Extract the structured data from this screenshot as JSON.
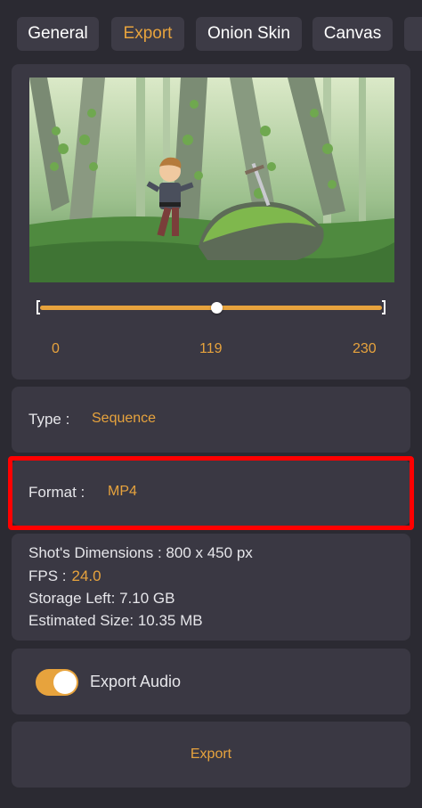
{
  "tabs": [
    {
      "label": "General",
      "active": false
    },
    {
      "label": "Export",
      "active": true
    },
    {
      "label": "Onion Skin",
      "active": false
    },
    {
      "label": "Canvas",
      "active": false
    }
  ],
  "timeline": {
    "start": "0",
    "current": "119",
    "end": "230",
    "current_value": 119,
    "max_value": 230
  },
  "type_row": {
    "label": "Type :",
    "value": "Sequence"
  },
  "format_row": {
    "label": "Format :",
    "value": "MP4"
  },
  "info": {
    "dimensions": "Shot's Dimensions : 800 x 450 px",
    "fps_label": "FPS :",
    "fps_value": "24.0",
    "storage": "Storage Left: 7.10 GB",
    "estimated": "Estimated Size: 10.35 MB"
  },
  "audio": {
    "label": "Export Audio",
    "enabled": true
  },
  "export_button": "Export",
  "colors": {
    "accent": "#e7a33d",
    "background": "#2b2a32",
    "panel": "#3a3843",
    "highlight": "#ff0000"
  },
  "icons": {
    "preview": "forest-knight-illustration"
  }
}
